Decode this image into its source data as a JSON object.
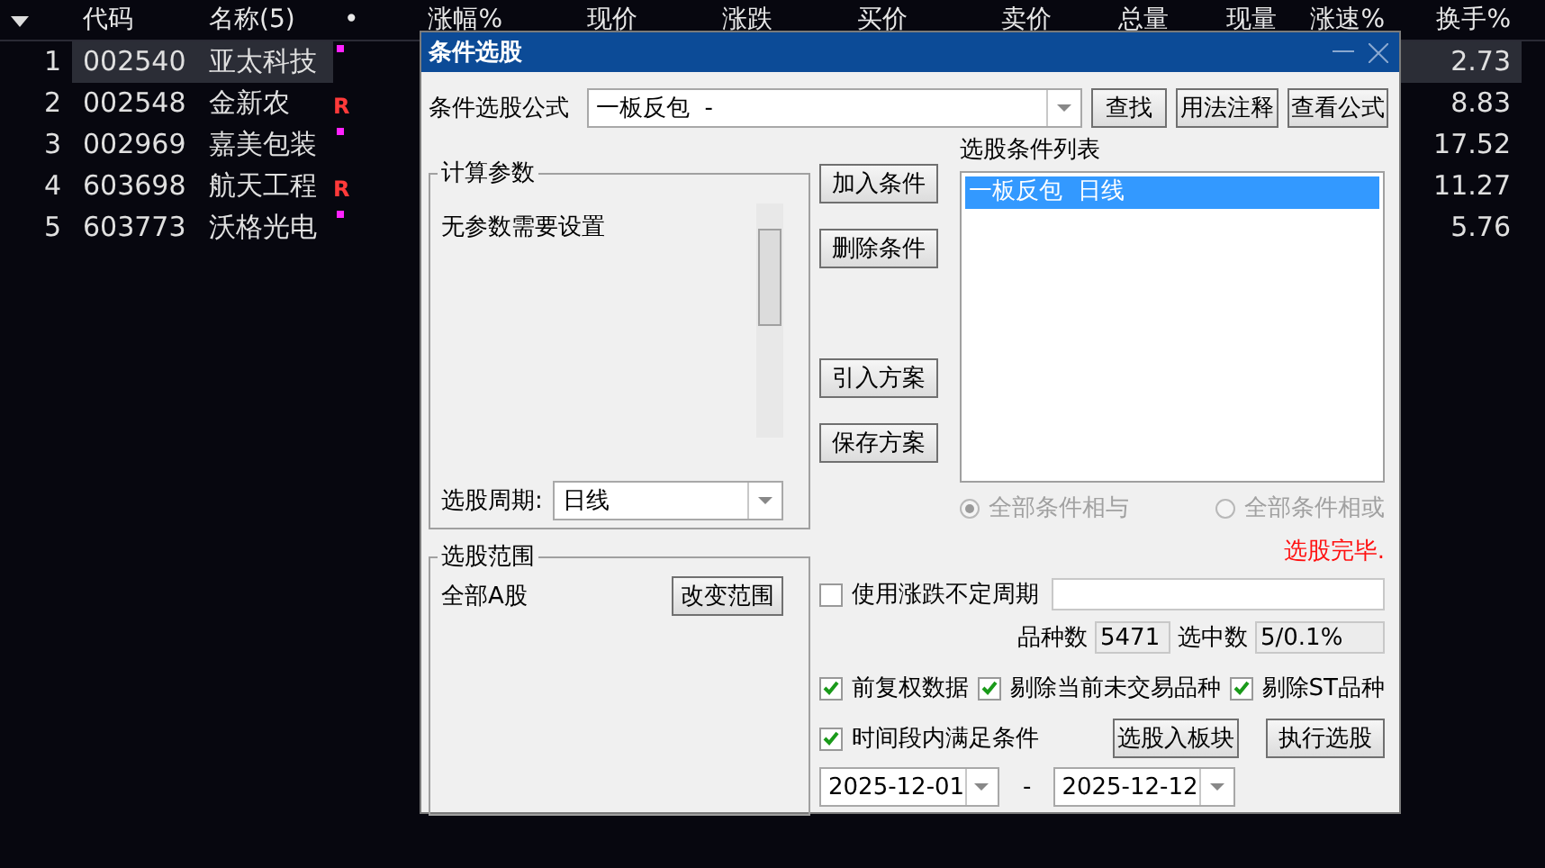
{
  "table": {
    "columns": [
      "代码",
      "名称(5)",
      "•",
      "涨幅%",
      "现价",
      "涨跌",
      "买价",
      "卖价",
      "总量",
      "现量",
      "涨速%",
      "换手%"
    ],
    "rows": [
      {
        "index": "1",
        "code": "002540",
        "name": "亚太科技",
        "flag": {
          "kind": "dot"
        },
        "turnover": "2.73",
        "selected": true
      },
      {
        "index": "2",
        "code": "002548",
        "name": "金新农",
        "flag": {
          "kind": "letter",
          "text": "R"
        },
        "turnover": "8.83",
        "selected": false
      },
      {
        "index": "3",
        "code": "002969",
        "name": "嘉美包装",
        "flag": {
          "kind": "dot"
        },
        "turnover": "17.52",
        "selected": false
      },
      {
        "index": "4",
        "code": "603698",
        "name": "航天工程",
        "flag": {
          "kind": "letter",
          "text": "R"
        },
        "turnover": "11.27",
        "selected": false
      },
      {
        "index": "5",
        "code": "603773",
        "name": "沃格光电",
        "flag": {
          "kind": "dot"
        },
        "turnover": "5.76",
        "selected": false
      }
    ]
  },
  "dialog": {
    "title": "条件选股",
    "formula": {
      "label": "条件选股公式",
      "value": "一板反包  -"
    },
    "top_buttons": [
      "查找",
      "用法注释",
      "查看公式"
    ],
    "params": {
      "legend": "计算参数",
      "message": "无参数需要设置",
      "period_label": "选股周期:",
      "period_value": "日线"
    },
    "range": {
      "legend": "选股范围",
      "value": "全部A股",
      "button": "改变范围"
    },
    "side_buttons": [
      "加入条件",
      "删除条件",
      "引入方案",
      "保存方案"
    ],
    "conditions": {
      "label": "选股条件列表",
      "items": [
        {
          "text": "一板反包  日线",
          "selected": true
        }
      ]
    },
    "logic": [
      {
        "label": "全部条件相与",
        "selected": true,
        "disabled": true
      },
      {
        "label": "全部条件相或",
        "selected": false,
        "disabled": true
      }
    ],
    "status": "选股完毕.",
    "variable_period": {
      "label": "使用涨跌不定周期",
      "checked": false
    },
    "counts": [
      {
        "label": "品种数",
        "value": "5471"
      },
      {
        "label": "选中数",
        "value": "5/0.1%"
      }
    ],
    "options": [
      {
        "label": "前复权数据",
        "checked": true
      },
      {
        "label": "剔除当前未交易品种",
        "checked": true
      },
      {
        "label": "剔除ST品种",
        "checked": true
      }
    ],
    "time_range": {
      "label": "时间段内满足条件",
      "checked": true,
      "start": "2025-12-01",
      "separator": "-",
      "end": "2025-12-12"
    },
    "action_buttons": [
      "选股入板块",
      "执行选股"
    ]
  }
}
